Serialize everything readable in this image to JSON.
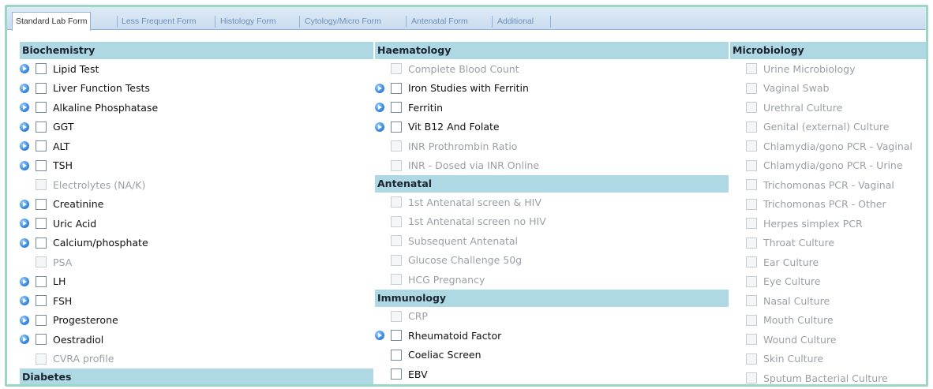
{
  "tabs": [
    {
      "label": "Standard Lab Form",
      "active": true
    },
    {
      "label": "Less Frequent Form",
      "active": false
    },
    {
      "label": "Histology Form",
      "active": false
    },
    {
      "label": "Cytology/Micro Form",
      "active": false
    },
    {
      "label": "Antenatal Form",
      "active": false
    },
    {
      "label": "Additional",
      "active": false
    }
  ],
  "columns": [
    {
      "sections": [
        {
          "title": "Biochemistry",
          "items": [
            {
              "label": "Lipid Test",
              "info": true,
              "enabled": true
            },
            {
              "label": "Liver Function Tests",
              "info": true,
              "enabled": true
            },
            {
              "label": "Alkaline Phosphatase",
              "info": true,
              "enabled": true
            },
            {
              "label": "GGT",
              "info": true,
              "enabled": true
            },
            {
              "label": "ALT",
              "info": true,
              "enabled": true
            },
            {
              "label": "TSH",
              "info": true,
              "enabled": true
            },
            {
              "label": "Electrolytes (NA/K)",
              "info": false,
              "enabled": false
            },
            {
              "label": "Creatinine",
              "info": true,
              "enabled": true
            },
            {
              "label": "Uric Acid",
              "info": true,
              "enabled": true
            },
            {
              "label": "Calcium/phosphate",
              "info": true,
              "enabled": true
            },
            {
              "label": "PSA",
              "info": false,
              "enabled": false
            },
            {
              "label": "LH",
              "info": true,
              "enabled": true
            },
            {
              "label": "FSH",
              "info": true,
              "enabled": true
            },
            {
              "label": "Progesterone",
              "info": true,
              "enabled": true
            },
            {
              "label": "Oestradiol",
              "info": true,
              "enabled": true
            },
            {
              "label": "CVRA profile",
              "info": false,
              "enabled": false
            }
          ]
        },
        {
          "title": "Diabetes",
          "items": []
        }
      ]
    },
    {
      "sections": [
        {
          "title": "Haematology",
          "items": [
            {
              "label": "Complete Blood Count",
              "info": false,
              "enabled": false
            },
            {
              "label": "Iron Studies with Ferritin",
              "info": true,
              "enabled": true
            },
            {
              "label": "Ferritin",
              "info": true,
              "enabled": true
            },
            {
              "label": "Vit B12 And Folate",
              "info": true,
              "enabled": true
            },
            {
              "label": "INR Prothrombin Ratio",
              "info": false,
              "enabled": false
            },
            {
              "label": "INR - Dosed via INR Online",
              "info": false,
              "enabled": false
            }
          ]
        },
        {
          "title": "Antenatal",
          "items": [
            {
              "label": "1st Antenatal screen & HIV",
              "info": false,
              "enabled": false
            },
            {
              "label": "1st Antenatal screen no HIV",
              "info": false,
              "enabled": false
            },
            {
              "label": "Subsequent Antenatal",
              "info": false,
              "enabled": false
            },
            {
              "label": "Glucose Challenge 50g",
              "info": false,
              "enabled": false
            },
            {
              "label": "HCG Pregnancy",
              "info": false,
              "enabled": false
            }
          ]
        },
        {
          "title": "Immunology",
          "items": [
            {
              "label": "CRP",
              "info": false,
              "enabled": false
            },
            {
              "label": "Rheumatoid Factor",
              "info": true,
              "enabled": true
            },
            {
              "label": "Coeliac Screen",
              "info": false,
              "enabled": true
            },
            {
              "label": "EBV",
              "info": false,
              "enabled": true
            }
          ]
        }
      ]
    },
    {
      "sections": [
        {
          "title": "Microbiology",
          "items": [
            {
              "label": "Urine Microbiology",
              "info": false,
              "enabled": false
            },
            {
              "label": "Vaginal Swab",
              "info": false,
              "enabled": false
            },
            {
              "label": "Urethral Culture",
              "info": false,
              "enabled": false
            },
            {
              "label": "Genital (external) Culture",
              "info": false,
              "enabled": false
            },
            {
              "label": "Chlamydia/gono PCR - Vaginal",
              "info": false,
              "enabled": false
            },
            {
              "label": "Chlamydia/gono PCR - Urine",
              "info": false,
              "enabled": false
            },
            {
              "label": "Trichomonas PCR - Vaginal",
              "info": false,
              "enabled": false
            },
            {
              "label": "Trichomonas PCR - Other",
              "info": false,
              "enabled": false
            },
            {
              "label": "Herpes simplex PCR",
              "info": false,
              "enabled": false
            },
            {
              "label": "Throat Culture",
              "info": false,
              "enabled": false
            },
            {
              "label": "Ear Culture",
              "info": false,
              "enabled": false
            },
            {
              "label": "Eye Culture",
              "info": false,
              "enabled": false
            },
            {
              "label": "Nasal Culture",
              "info": false,
              "enabled": false
            },
            {
              "label": "Mouth Culture",
              "info": false,
              "enabled": false
            },
            {
              "label": "Wound Culture",
              "info": false,
              "enabled": false
            },
            {
              "label": "Skin Culture",
              "info": false,
              "enabled": false
            },
            {
              "label": "Sputum Bacterial Culture",
              "info": false,
              "enabled": false
            }
          ]
        }
      ]
    }
  ]
}
